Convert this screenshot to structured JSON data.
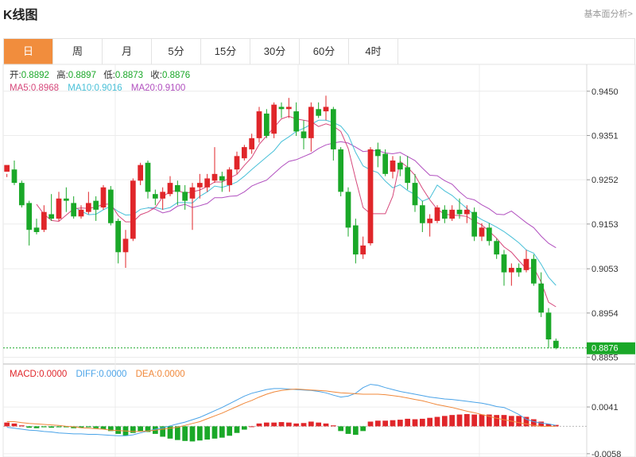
{
  "header": {
    "title": "K线图",
    "link": "基本面分析>"
  },
  "tabs": [
    {
      "label": "日",
      "active": true
    },
    {
      "label": "周",
      "active": false
    },
    {
      "label": "月",
      "active": false
    },
    {
      "label": "5分",
      "active": false
    },
    {
      "label": "15分",
      "active": false
    },
    {
      "label": "30分",
      "active": false
    },
    {
      "label": "60分",
      "active": false
    },
    {
      "label": "4时",
      "active": false
    }
  ],
  "legend": {
    "ohlc": [
      {
        "label": "开:",
        "value": "0.8892"
      },
      {
        "label": "高:",
        "value": "0.8897"
      },
      {
        "label": "低:",
        "value": "0.8873"
      },
      {
        "label": "收:",
        "value": "0.8876"
      }
    ],
    "ma": [
      {
        "label": "MA5:",
        "value": "0.8968",
        "color": "#d6487b"
      },
      {
        "label": "MA10:",
        "value": "0.9016",
        "color": "#48c0d8"
      },
      {
        "label": "MA20:",
        "value": "0.9100",
        "color": "#b14fbf"
      }
    ],
    "macd": [
      {
        "label": "MACD:",
        "value": "0.0000",
        "color": "#e0262a"
      },
      {
        "label": "DIFF:",
        "value": "0.0000",
        "color": "#4aa3e8"
      },
      {
        "label": "DEA:",
        "value": "0.0000",
        "color": "#f0883a"
      }
    ]
  },
  "colors": {
    "up": "#e0262a",
    "down": "#1aa828",
    "last_price_bg": "#1aa828"
  },
  "chart_data": [
    {
      "type": "candlestick",
      "y_ticks": [
        "0.9450",
        "0.9351",
        "0.9252",
        "0.9153",
        "0.9053",
        "0.8954",
        "0.8855"
      ],
      "ylim": [
        0.884,
        0.951
      ],
      "last_price": "0.8876",
      "candles": [
        [
          0.927,
          0.9285,
          0.9265,
          0.9258
        ],
        [
          0.9275,
          0.9245,
          0.9295,
          0.924
        ],
        [
          0.9245,
          0.9195,
          0.925,
          0.919
        ],
        [
          0.92,
          0.914,
          0.9205,
          0.9105
        ],
        [
          0.9145,
          0.9135,
          0.9165,
          0.913
        ],
        [
          0.914,
          0.918,
          0.9195,
          0.9135
        ],
        [
          0.9175,
          0.9165,
          0.922,
          0.916
        ],
        [
          0.9165,
          0.921,
          0.9225,
          0.916
        ],
        [
          0.921,
          0.9205,
          0.9235,
          0.918
        ],
        [
          0.92,
          0.917,
          0.9215,
          0.9165
        ],
        [
          0.917,
          0.9185,
          0.9195,
          0.9165
        ],
        [
          0.918,
          0.92,
          0.9225,
          0.9175
        ],
        [
          0.9205,
          0.9185,
          0.9215,
          0.916
        ],
        [
          0.919,
          0.9235,
          0.924,
          0.9185
        ],
        [
          0.923,
          0.9155,
          0.9238,
          0.915
        ],
        [
          0.916,
          0.909,
          0.9165,
          0.9065
        ],
        [
          0.909,
          0.912,
          0.914,
          0.9055
        ],
        [
          0.912,
          0.925,
          0.9255,
          0.9115
        ],
        [
          0.925,
          0.9285,
          0.929,
          0.924
        ],
        [
          0.929,
          0.9225,
          0.9295,
          0.921
        ],
        [
          0.922,
          0.921,
          0.923,
          0.9195
        ],
        [
          0.921,
          0.9225,
          0.9235,
          0.9185
        ],
        [
          0.922,
          0.9245,
          0.926,
          0.9215
        ],
        [
          0.924,
          0.9225,
          0.925,
          0.9195
        ],
        [
          0.9225,
          0.9205,
          0.924,
          0.9185
        ],
        [
          0.921,
          0.9235,
          0.9245,
          0.914
        ],
        [
          0.9235,
          0.9245,
          0.9265,
          0.921
        ],
        [
          0.9235,
          0.9255,
          0.9265,
          0.9225
        ],
        [
          0.925,
          0.9265,
          0.9325,
          0.9245
        ],
        [
          0.926,
          0.925,
          0.927,
          0.9225
        ],
        [
          0.924,
          0.9275,
          0.928,
          0.9225
        ],
        [
          0.9275,
          0.9305,
          0.9315,
          0.9265
        ],
        [
          0.93,
          0.9325,
          0.933,
          0.9295
        ],
        [
          0.932,
          0.9345,
          0.9355,
          0.931
        ],
        [
          0.9345,
          0.9405,
          0.9415,
          0.9335
        ],
        [
          0.94,
          0.935,
          0.941,
          0.9345
        ],
        [
          0.9355,
          0.942,
          0.9425,
          0.9345
        ],
        [
          0.9415,
          0.941,
          0.9425,
          0.939
        ],
        [
          0.941,
          0.9415,
          0.9435,
          0.939
        ],
        [
          0.9405,
          0.936,
          0.9425,
          0.935
        ],
        [
          0.936,
          0.9345,
          0.9385,
          0.932
        ],
        [
          0.9345,
          0.9415,
          0.9425,
          0.9315
        ],
        [
          0.941,
          0.9395,
          0.9425,
          0.939
        ],
        [
          0.9405,
          0.9415,
          0.944,
          0.9385
        ],
        [
          0.941,
          0.932,
          0.9415,
          0.9295
        ],
        [
          0.932,
          0.9225,
          0.9325,
          0.9215
        ],
        [
          0.9225,
          0.9145,
          0.9235,
          0.9125
        ],
        [
          0.915,
          0.9085,
          0.9165,
          0.9065
        ],
        [
          0.9085,
          0.9105,
          0.9125,
          0.9075
        ],
        [
          0.911,
          0.932,
          0.9325,
          0.9105
        ],
        [
          0.932,
          0.9305,
          0.9335,
          0.928
        ],
        [
          0.931,
          0.9265,
          0.932,
          0.926
        ],
        [
          0.927,
          0.9295,
          0.9305,
          0.9255
        ],
        [
          0.929,
          0.9275,
          0.9305,
          0.926
        ],
        [
          0.928,
          0.9245,
          0.9305,
          0.923
        ],
        [
          0.9245,
          0.9195,
          0.9265,
          0.918
        ],
        [
          0.9195,
          0.9155,
          0.9205,
          0.9135
        ],
        [
          0.9155,
          0.9165,
          0.9175,
          0.9125
        ],
        [
          0.916,
          0.919,
          0.9195,
          0.9155
        ],
        [
          0.9185,
          0.9165,
          0.9195,
          0.9155
        ],
        [
          0.9165,
          0.9185,
          0.9195,
          0.916
        ],
        [
          0.9185,
          0.9175,
          0.921,
          0.9165
        ],
        [
          0.9175,
          0.9185,
          0.9195,
          0.9155
        ],
        [
          0.918,
          0.9125,
          0.919,
          0.9115
        ],
        [
          0.9125,
          0.9145,
          0.9155,
          0.9115
        ],
        [
          0.9145,
          0.9115,
          0.9155,
          0.9105
        ],
        [
          0.9115,
          0.9085,
          0.912,
          0.9075
        ],
        [
          0.9085,
          0.9045,
          0.9095,
          0.9015
        ],
        [
          0.9045,
          0.9055,
          0.9065,
          0.9015
        ],
        [
          0.9055,
          0.9045,
          0.9065,
          0.9035
        ],
        [
          0.905,
          0.9075,
          0.9095,
          0.9045
        ],
        [
          0.9075,
          0.902,
          0.9085,
          0.9015
        ],
        [
          0.902,
          0.8955,
          0.9045,
          0.8945
        ],
        [
          0.8955,
          0.8895,
          0.8965,
          0.8875
        ],
        [
          0.8892,
          0.8876,
          0.8897,
          0.8873
        ]
      ],
      "ma5": [
        null,
        null,
        null,
        null,
        0.9197,
        0.9175,
        0.9161,
        0.9159,
        0.9173,
        0.9187,
        0.9189,
        0.9188,
        0.9191,
        0.9197,
        0.9198,
        0.9172,
        0.9158,
        0.9158,
        0.9174,
        0.918,
        0.919,
        0.9214,
        0.9226,
        0.9228,
        0.9222,
        0.9225,
        0.9229,
        0.9237,
        0.9247,
        0.9247,
        0.9256,
        0.9264,
        0.9284,
        0.9302,
        0.9331,
        0.935,
        0.9369,
        0.9388,
        0.9394,
        0.9388,
        0.9385,
        0.9382,
        0.9371,
        0.9377,
        0.9372,
        0.936,
        0.9322,
        0.9254,
        0.919,
        0.9176,
        0.9176,
        0.9176,
        0.9215,
        0.9293,
        0.928,
        0.9262,
        0.9233,
        0.9207,
        0.9186,
        0.9175,
        0.9173,
        0.9172,
        0.917,
        0.9159,
        0.9151,
        0.9137,
        0.9121,
        0.9102,
        0.909,
        0.9071,
        0.9053,
        0.9056,
        0.9023,
        0.8978,
        0.8968
      ],
      "ma10": [
        null,
        null,
        null,
        null,
        null,
        null,
        null,
        null,
        null,
        0.9192,
        0.9182,
        0.9174,
        0.9175,
        0.9185,
        0.9193,
        0.9181,
        0.9173,
        0.9174,
        0.9186,
        0.9189,
        0.919,
        0.9186,
        0.919,
        0.9201,
        0.9201,
        0.92,
        0.9215,
        0.9225,
        0.9238,
        0.9235,
        0.924,
        0.9247,
        0.926,
        0.9275,
        0.9289,
        0.9303,
        0.9317,
        0.9337,
        0.9348,
        0.936,
        0.9367,
        0.9376,
        0.9385,
        0.9385,
        0.938,
        0.9372,
        0.9352,
        0.9313,
        0.9283,
        0.9274,
        0.9268,
        0.9249,
        0.9234,
        0.9241,
        0.9228,
        0.9219,
        0.9204,
        0.9211,
        0.924,
        0.9227,
        0.9217,
        0.9202,
        0.9188,
        0.9173,
        0.9163,
        0.9155,
        0.9146,
        0.9136,
        0.9124,
        0.9111,
        0.9095,
        0.9088,
        0.9063,
        0.9034,
        0.9016
      ],
      "ma20": [
        null,
        null,
        null,
        null,
        null,
        null,
        null,
        null,
        null,
        null,
        null,
        null,
        null,
        null,
        null,
        null,
        null,
        null,
        null,
        0.919,
        0.9186,
        0.9178,
        0.9182,
        0.9193,
        0.9197,
        0.919,
        0.9194,
        0.9199,
        0.9212,
        0.9212,
        0.9215,
        0.9216,
        0.9225,
        0.9238,
        0.9245,
        0.9251,
        0.9266,
        0.9281,
        0.9293,
        0.9297,
        0.9304,
        0.9311,
        0.9322,
        0.933,
        0.9334,
        0.9337,
        0.9334,
        0.9325,
        0.9315,
        0.9317,
        0.9317,
        0.9312,
        0.931,
        0.9313,
        0.9304,
        0.9295,
        0.9278,
        0.9262,
        0.9261,
        0.925,
        0.9242,
        0.9225,
        0.9211,
        0.9207,
        0.9196,
        0.9187,
        0.9175,
        0.9174,
        0.9182,
        0.9169,
        0.9156,
        0.9145,
        0.9126,
        0.911,
        0.91
      ]
    },
    {
      "type": "bar",
      "y_ticks": [
        "0.0041",
        "-0.0058"
      ],
      "ylim": [
        -0.0065,
        0.0095
      ],
      "macd": [
        0.0008,
        0.0006,
        0.0002,
        -0.0003,
        -0.0004,
        -0.0002,
        -0.0003,
        -0.0002,
        -0.0002,
        -0.0004,
        -0.0003,
        -0.0002,
        -0.0004,
        -0.0006,
        -0.001,
        -0.0016,
        -0.002,
        -0.0014,
        -0.001,
        -0.0012,
        -0.0016,
        -0.0022,
        -0.0026,
        -0.0029,
        -0.0031,
        -0.0032,
        -0.003,
        -0.0028,
        -0.0026,
        -0.0024,
        -0.002,
        -0.0014,
        -0.0007,
        0.0,
        0.0006,
        0.0008,
        0.0008,
        0.0009,
        0.0008,
        0.0006,
        0.0007,
        0.001,
        0.0008,
        0.0006,
        0.0002,
        -0.001,
        -0.0016,
        -0.0018,
        -0.001,
        0.001,
        0.0012,
        0.0012,
        0.0013,
        0.0014,
        0.0016,
        0.0015,
        0.0016,
        0.0018,
        0.002,
        0.0022,
        0.0024,
        0.0025,
        0.0026,
        0.0025,
        0.0025,
        0.0025,
        0.0024,
        0.0024,
        0.0022,
        0.0022,
        0.002,
        0.0015,
        0.001,
        0.0005,
        0.0003
      ],
      "diff": [
        -0.0002,
        -0.0004,
        -0.0006,
        -0.0008,
        -0.0009,
        -0.0011,
        -0.0012,
        -0.0014,
        -0.0015,
        -0.0016,
        -0.0016,
        -0.0017,
        -0.0017,
        -0.0018,
        -0.0019,
        -0.002,
        -0.002,
        -0.0018,
        -0.0014,
        -0.001,
        -0.0006,
        -0.0003,
        0.0001,
        0.0005,
        0.0009,
        0.0014,
        0.0019,
        0.0026,
        0.0033,
        0.004,
        0.0048,
        0.0056,
        0.0064,
        0.007,
        0.0074,
        0.0078,
        0.008,
        0.008,
        0.0079,
        0.0078,
        0.0077,
        0.0076,
        0.0074,
        0.0071,
        0.0066,
        0.0062,
        0.0064,
        0.007,
        0.0082,
        0.0089,
        0.0087,
        0.0082,
        0.0078,
        0.0074,
        0.0071,
        0.0068,
        0.0065,
        0.0062,
        0.006,
        0.0058,
        0.0057,
        0.0055,
        0.0053,
        0.0051,
        0.0049,
        0.0046,
        0.0042,
        0.004,
        0.0033,
        0.0025,
        0.0015,
        0.001,
        0.0007,
        0.0005,
        0.0002
      ],
      "dea": [
        0.001,
        0.001,
        0.0008,
        0.0006,
        0.0005,
        0.0004,
        0.0003,
        0.0002,
        0.0,
        -0.0001,
        -0.0003,
        -0.0004,
        -0.0005,
        -0.0006,
        -0.0008,
        -0.0009,
        -0.001,
        -0.0011,
        -0.0011,
        -0.001,
        -0.0008,
        -0.0006,
        -0.0004,
        -0.0002,
        0.0002,
        0.0006,
        0.001,
        0.0016,
        0.0022,
        0.0028,
        0.0035,
        0.0042,
        0.0049,
        0.0055,
        0.0062,
        0.0068,
        0.0073,
        0.0076,
        0.0078,
        0.0079,
        0.0078,
        0.0077,
        0.0076,
        0.0075,
        0.0073,
        0.0071,
        0.007,
        0.0069,
        0.0068,
        0.0068,
        0.0068,
        0.0067,
        0.0065,
        0.0063,
        0.006,
        0.0057,
        0.0054,
        0.005,
        0.0046,
        0.0043,
        0.004,
        0.0036,
        0.0032,
        0.0029,
        0.0025,
        0.0021,
        0.0017,
        0.0014,
        0.0011,
        0.0008,
        0.0005,
        0.0002,
        0.0,
        0.0,
        0.0
      ]
    }
  ]
}
